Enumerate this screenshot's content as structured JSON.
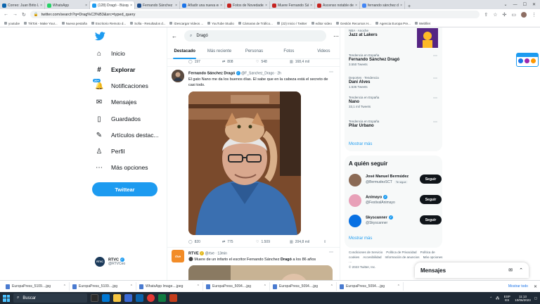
{
  "browser": {
    "tabs": [
      {
        "title": "Correo: Juan Brito Lo",
        "color": "#0a64ad"
      },
      {
        "title": "WhatsApp",
        "color": "#25d366"
      },
      {
        "title": "(128) Dragó - Búsque",
        "color": "#1d9bf0",
        "active": true
      },
      {
        "title": "Fernando Sánchez Dr",
        "color": "#1a4b8c"
      },
      {
        "title": "Añadir una nueva en",
        "color": "#1a73e8"
      },
      {
        "title": "Fotos de Novedades",
        "color": "#c5221f"
      },
      {
        "title": "Muere Fernando Sá",
        "color": "#c5221f"
      },
      {
        "title": "Ascenso notable de",
        "color": "#c5221f"
      },
      {
        "title": "fernando sánchez dr",
        "color": "#4285f4"
      }
    ],
    "window_buttons": [
      "⌄",
      "—",
      "☐",
      "✕"
    ],
    "url": "twitter.com/search?q=Drag%C3%B3&src=typed_query",
    "bookmarks": [
      "youtube",
      "TikTok - Make Your...",
      "Nueva pestaña",
      "Escritorio Remoto d...",
      "Sofia - Resultados d...",
      "iDescargar Videos ...",
      "YouTube Studio",
      "Cámaras de Tráfico...",
      "(22) Inicio / Twitter",
      "editor video",
      "Gestión Recursos H...",
      "Agencia Europa Pre...",
      "Webfilet"
    ]
  },
  "nav": {
    "items": [
      {
        "label": "Inicio",
        "icon": "home-icon",
        "glyph": "⌂"
      },
      {
        "label": "Explorar",
        "icon": "hashtag-icon",
        "glyph": "#",
        "active": true
      },
      {
        "label": "Notificaciones",
        "icon": "bell-icon",
        "glyph": "🔔",
        "badge": "20+"
      },
      {
        "label": "Mensajes",
        "icon": "mail-icon",
        "glyph": "✉"
      },
      {
        "label": "Guardados",
        "icon": "bookmark-icon",
        "glyph": "▯"
      },
      {
        "label": "Artículos destac...",
        "icon": "feather-icon",
        "glyph": "✎"
      },
      {
        "label": "Perfil",
        "icon": "person-icon",
        "glyph": "♙"
      },
      {
        "label": "Más opciones",
        "icon": "more-icon",
        "glyph": "⋯"
      }
    ],
    "tweet_button": "Twittear",
    "account": {
      "name": "RTVC",
      "handle": "@RTVCeo",
      "avatar_text": "RTVC"
    }
  },
  "search": {
    "query": "Dragó",
    "tabs": [
      "Destacado",
      "Más reciente",
      "Personas",
      "Fotos",
      "Videos"
    ]
  },
  "prev_tweet_stats": {
    "replies": "197",
    "retweets": "808",
    "likes": "548",
    "views": "168,4 mil"
  },
  "tweet": {
    "author": "Fernando Sánchez Dragó",
    "handle": "@F_Sanchez_Drago",
    "time": "2h",
    "text": "El gato Nano me da los buenos días. El sabe que en la cabeza está el secreto de casi todo.",
    "stats": {
      "replies": "820",
      "retweets": "775",
      "likes": "1.509",
      "views": "204,8 mil"
    }
  },
  "rtve_tweet": {
    "author": "RTVE",
    "handle": "@rtve",
    "time": "13min",
    "avatar_text": "rtve",
    "text_before": "Muere de un infarto el escritor Fernando Sánchez",
    "text_bold": "Dragó",
    "text_after": "a los 86 años"
  },
  "trends": {
    "top": {
      "category": "NBA · Anoche",
      "name": "Jazz at Lakers"
    },
    "items": [
      {
        "category": "Tendencia en España",
        "name": "Fernando Sánchez Dragó",
        "count": "3.550 Tweets"
      },
      {
        "category": "Deportes · Tendencia",
        "name": "Dani Alves",
        "count": "1.536 Tweets"
      },
      {
        "category": "Tendencia en España",
        "name": "Nano",
        "count": "33,1 mil Tweets"
      },
      {
        "category": "Tendencia en España",
        "name": "Pilar Urbano",
        "count": ""
      }
    ],
    "more": "Mostrar más"
  },
  "who_to_follow": {
    "title": "A quién seguir",
    "items": [
      {
        "name": "José Manuel Bermúdez",
        "handle": "@BermudezSCT",
        "follows_you": "Te sigue",
        "button": "Seguir",
        "color": "#8b6a55"
      },
      {
        "name": "Animayo",
        "handle": "@FestivalAnimayo",
        "follows_you": "",
        "button": "Seguir",
        "color": "#e8a0b8"
      },
      {
        "name": "Skyscanner",
        "handle": "@Skyscanner",
        "follows_you": "",
        "button": "Seguir",
        "color": "#0770e3"
      }
    ],
    "more": "Mostrar más"
  },
  "footer": {
    "links": [
      "Condiciones de Servicio",
      "Política de Privacidad",
      "Política de cookies",
      "Accesibilidad",
      "Información de anuncios",
      "Más opciones ···"
    ],
    "copyright": "© 2023 Twitter, Inc."
  },
  "messages": {
    "title": "Mensajes"
  },
  "downloads": {
    "items": [
      "EuropaPress_5109....jpg",
      "EuropaPress_5109....jpg",
      "WhatsApp Image....jpeg",
      "EuropaPress_5094....jpg",
      "EuropaPress_5094....jpg",
      "EuropaPress_5094....jpg"
    ],
    "show_all": "Mostrar todo"
  },
  "taskbar": {
    "search_placeholder": "Buscar",
    "lang": "ESP ES",
    "time": "11:13",
    "date": "10/06/2023"
  }
}
